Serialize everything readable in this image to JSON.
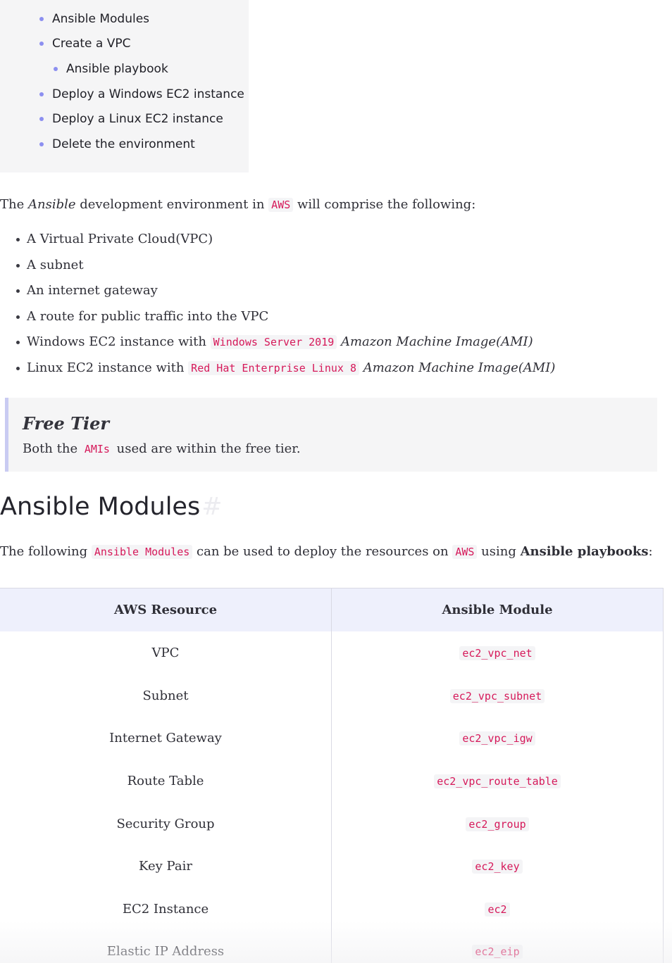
{
  "toc": {
    "items": [
      {
        "label": "Ansible Modules",
        "level": 1
      },
      {
        "label": "Create a VPC",
        "level": 1
      },
      {
        "label": "Ansible playbook",
        "level": 2
      },
      {
        "label": "Deploy a Windows EC2 instance",
        "level": 1
      },
      {
        "label": "Deploy a Linux EC2 instance",
        "level": 1
      },
      {
        "label": "Delete the environment",
        "level": 1
      }
    ]
  },
  "intro": {
    "part1": "The ",
    "em": "Ansible",
    "part2": " development environment in ",
    "code": "AWS",
    "part3": " will comprise the following:"
  },
  "components": {
    "b1": "A Virtual Private Cloud(VPC)",
    "b2": "A subnet",
    "b3": "An internet gateway",
    "b4": "A route for public traffic into the VPC",
    "b5_pre": "Windows EC2 instance with ",
    "b5_code": "Windows Server 2019",
    "b5_em": " Amazon Machine Image(AMI)",
    "b6_pre": "Linux EC2 instance with ",
    "b6_code": "Red Hat Enterprise Linux 8",
    "b6_em": " Amazon Machine Image(AMI)"
  },
  "callout": {
    "title": "Free Tier",
    "pre": "Both the ",
    "code": "AMIs",
    "post": " used are within the free tier."
  },
  "section": {
    "heading": "Ansible Modules",
    "anchor": "#",
    "p_pre": "The following ",
    "p_code1": "Ansible Modules",
    "p_mid": " can be used to deploy the resources on ",
    "p_code2": "AWS",
    "p_mid2": " using ",
    "p_strong": "Ansible playbooks",
    "p_end": ":"
  },
  "table": {
    "headers": [
      "AWS Resource",
      "Ansible Module"
    ],
    "rows": [
      [
        "VPC",
        "ec2_vpc_net"
      ],
      [
        "Subnet",
        "ec2_vpc_subnet"
      ],
      [
        "Internet Gateway",
        "ec2_vpc_igw"
      ],
      [
        "Route Table",
        "ec2_vpc_route_table"
      ],
      [
        "Security Group",
        "ec2_group"
      ],
      [
        "Key Pair",
        "ec2_key"
      ],
      [
        "EC2 Instance",
        "ec2"
      ],
      [
        "Elastic IP Address",
        "ec2_eip"
      ]
    ]
  }
}
